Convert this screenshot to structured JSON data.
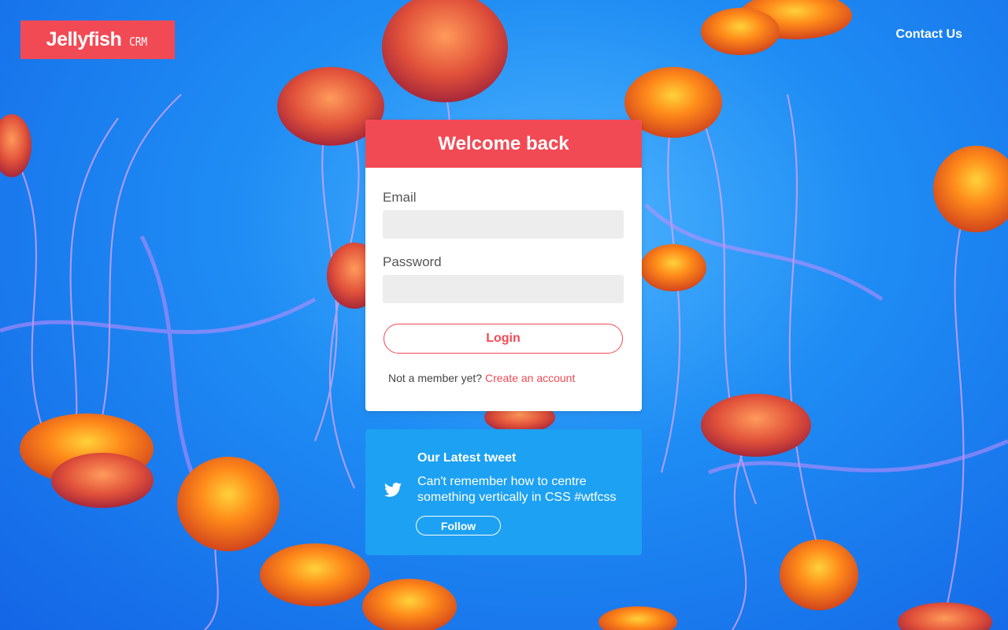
{
  "header": {
    "brand": "Jellyfish",
    "brand_suffix": "CRM",
    "contact_label": "Contact Us"
  },
  "login": {
    "title": "Welcome back",
    "email_label": "Email",
    "email_value": "",
    "password_label": "Password",
    "password_value": "",
    "login_label": "Login",
    "not_member_text": "Not a member yet?",
    "create_account_label": "Create an account"
  },
  "tweet": {
    "title": "Our Latest tweet",
    "text": "Can't remember how to centre something vertically in CSS #wtfcss",
    "follow_label": "Follow",
    "icon": "twitter-icon"
  },
  "colors": {
    "accent": "#f24a55",
    "twitter": "#1da1f2",
    "input_bg": "#ededed"
  }
}
